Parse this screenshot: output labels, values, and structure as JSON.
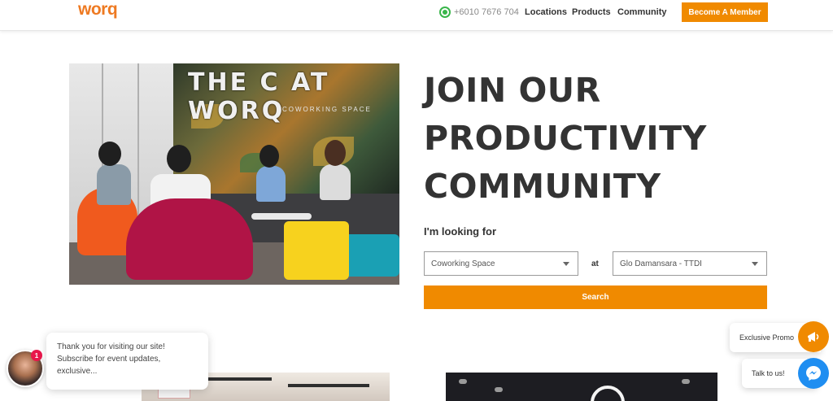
{
  "header": {
    "logo": "worq",
    "phone": "+6010 7676 704",
    "nav": [
      "Locations",
      "Products",
      "Community"
    ],
    "cta_label": "Become A Member"
  },
  "hero": {
    "headline_lines": [
      "JOIN OUR",
      "PRODUCTIVITY",
      "COMMUNITY"
    ],
    "mural_text": "THE C  AT WORQ",
    "mural_subtext": "COWORKING SPACE"
  },
  "search": {
    "looking_for_label": "I'm looking for",
    "space_type_value": "Coworking Space",
    "at_label": "at",
    "location_value": "Glo Damansara - TTDI",
    "search_label": "Search"
  },
  "chat": {
    "badge_count": "1",
    "message_lines": [
      "Thank you for visiting our site!",
      "Subscribe for event updates,",
      "exclusive..."
    ]
  },
  "widgets": {
    "promo_label": "Exclusive Promo",
    "talk_label": "Talk to us!"
  },
  "colors": {
    "accent": "#f08a00",
    "logo": "#ee7a22",
    "headline": "#333333",
    "messenger": "#1f8ef1",
    "whatsapp": "#39b54a",
    "badge": "#e8174b"
  },
  "icons": {
    "phone": "whatsapp-icon",
    "promo": "megaphone-icon",
    "talk": "messenger-icon",
    "select_caret": "caret-down-icon"
  }
}
